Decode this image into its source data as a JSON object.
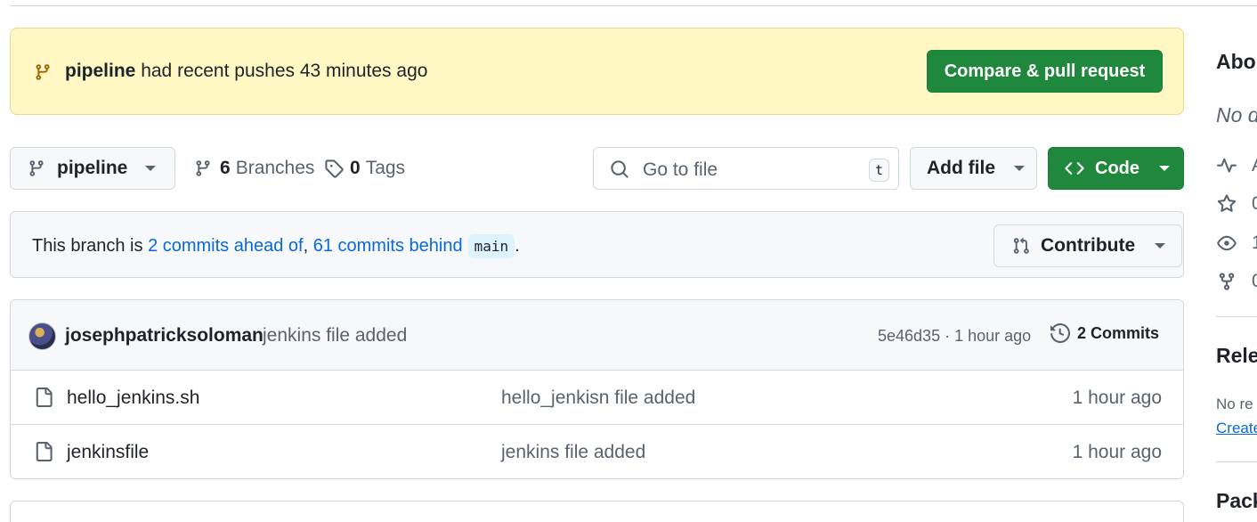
{
  "banner": {
    "branch": "pipeline",
    "message": "had recent pushes 43 minutes ago",
    "compare_button": "Compare & pull request"
  },
  "toolbar": {
    "branch_name": "pipeline",
    "branches_count": "6",
    "branches_label": "Branches",
    "tags_count": "0",
    "tags_label": "Tags",
    "search_placeholder": "Go to file",
    "search_shortcut": "t",
    "add_file_label": "Add file",
    "code_label": "Code"
  },
  "status": {
    "prefix": "This branch is",
    "ahead": "2 commits ahead of",
    "separator": ",",
    "behind": "61 commits behind",
    "base_branch": "main",
    "suffix": ".",
    "contribute_label": "Contribute"
  },
  "latest_commit": {
    "author": "josephpatricksoloman",
    "message": "jenkins file added",
    "sha_time": "5e46d35 · 1 hour ago",
    "commits_label": "2 Commits"
  },
  "files": [
    {
      "name": "hello_jenkins.sh",
      "message": "hello_jenkisn file added",
      "age": "1 hour ago"
    },
    {
      "name": "jenkinsfile",
      "message": "jenkins file added",
      "age": "1 hour ago"
    }
  ],
  "sidebar": {
    "about_heading": "Abo",
    "no_description": "No d",
    "stats": [
      "A",
      "0",
      "1",
      "0"
    ],
    "releases_heading": "Rele",
    "no_releases": "No re",
    "create_link": "Create",
    "packages_heading": "Pack"
  },
  "colors": {
    "banner_bg": "#fff8c5",
    "primary_green": "#1f883d",
    "link_blue": "#0969da",
    "muted_text": "#59636e",
    "border": "#d1d9e0"
  }
}
